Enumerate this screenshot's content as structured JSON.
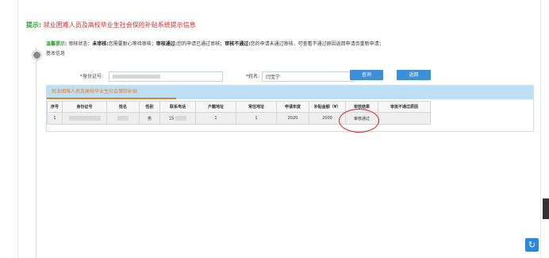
{
  "tip": {
    "label": "提示:",
    "text": "就业困难人员及高校毕业生社会保险补贴系统提示信息"
  },
  "notice": {
    "label": "温馨提示:",
    "p1": "审核状态：",
    "k1": "未审核:",
    "p2": "您需要耐心等待审核；",
    "k2": "审核通过:",
    "p3": "您的申请已通过审核；",
    "k3": "审核不通过:",
    "p4": "您的申请未通过审核，可查看不通过原因返回申请页重新申请；"
  },
  "basic_info": "基本信息",
  "form": {
    "id_label": "*身份证号:",
    "name_label": "*姓名:",
    "name_value": "闫宝宁",
    "query_button": "查询",
    "back_button": "返回"
  },
  "panel": {
    "title": "就业困难人员及高校毕业生社会保险补贴"
  },
  "table": {
    "headers": [
      "序号",
      "身份证号",
      "姓名",
      "性别",
      "联系电话",
      "户籍地址",
      "常住地址",
      "申请年度",
      "补贴金额（¥）",
      "审核结果",
      "审批不通过原因"
    ],
    "rows": [
      {
        "index": "1",
        "gender": "男",
        "phone_prefix": "15",
        "household": "1",
        "residence": "1",
        "year": "2020",
        "amount": "2000",
        "result": "审核通过",
        "reason": ""
      }
    ]
  },
  "colors": {
    "accent_blue": "#3e8ed8",
    "tip_green": "#2e9b2e",
    "tip_red": "#d42a2a",
    "panel_header": "#bfe0f4",
    "panel_title": "#e07a2b",
    "highlight_circle": "#dd2222"
  },
  "icons": {
    "refresh": "refresh-icon",
    "timeline": "timeline-dot-icon"
  }
}
